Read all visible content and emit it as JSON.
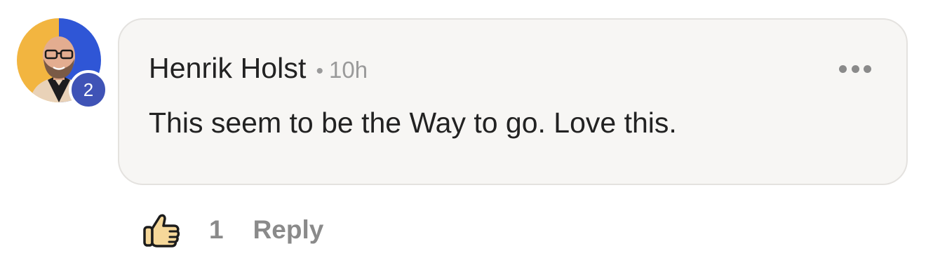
{
  "comment": {
    "author": "Henrik Holst",
    "separator": "•",
    "time": "10h",
    "text": "This seem to be the Way to go. Love this.",
    "avatar": {
      "level_badge": "2",
      "ring_colors": [
        "#2f56d6",
        "#f2b540"
      ],
      "badge_color": "#3f53b6"
    },
    "more_icon": "more-horizontal-icon"
  },
  "actions": {
    "like_icon": "thumbs-up-icon",
    "like_count": "1",
    "reply_label": "Reply"
  },
  "colors": {
    "bubble_bg": "#f7f6f4",
    "text": "#222222",
    "muted": "#8a8a8a",
    "like_icon_fill": "#f6d89a"
  }
}
